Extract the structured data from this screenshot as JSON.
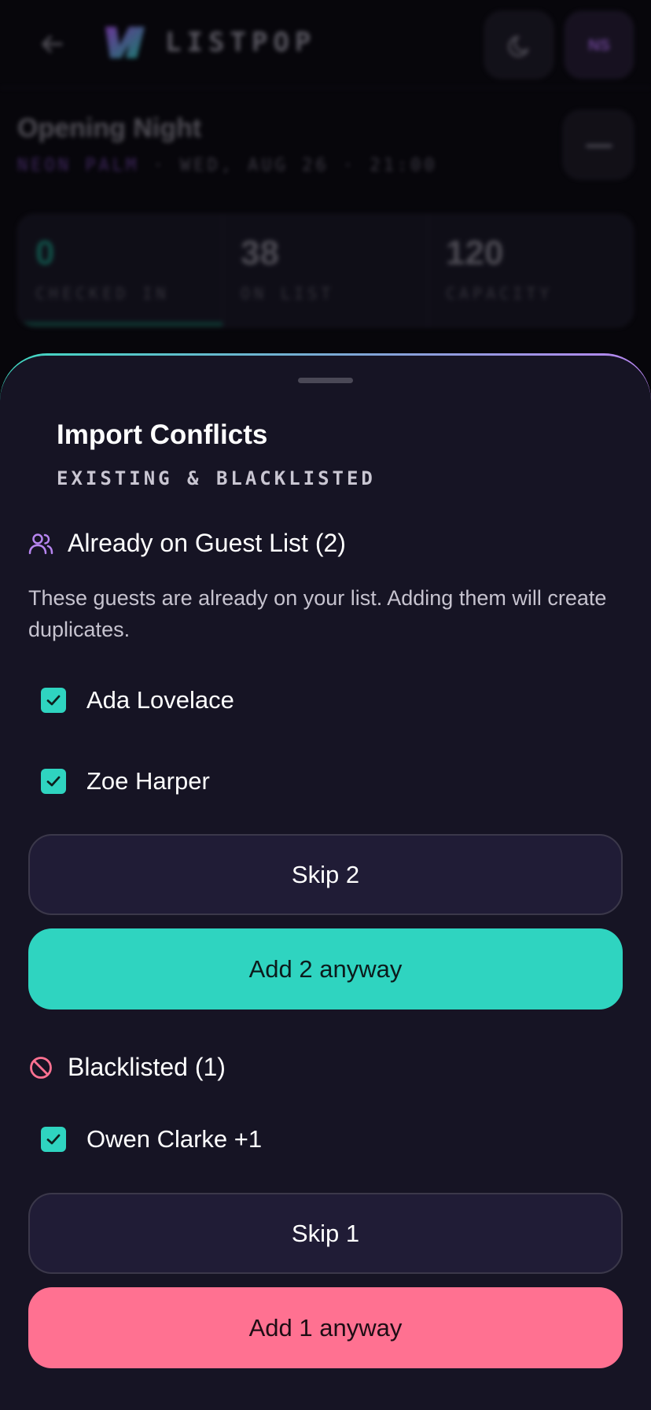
{
  "app": {
    "brand": "LISTPOP",
    "avatar_initials": "NS"
  },
  "event": {
    "title": "Opening Night",
    "venue": "NEON PALM",
    "datetime": "· WED, AUG 26 · 21:00"
  },
  "stats": [
    {
      "value": "0",
      "label": "CHECKED IN"
    },
    {
      "value": "38",
      "label": "ON LIST"
    },
    {
      "value": "120",
      "label": "CAPACITY"
    }
  ],
  "sheet": {
    "title": "Import Conflicts",
    "subtitle": "EXISTING & BLACKLISTED",
    "existing": {
      "heading": "Already on Guest List (2)",
      "description": "These guests are already on your list. Adding them will create duplicates.",
      "guests": [
        "Ada Lovelace",
        "Zoe Harper"
      ],
      "skip_label": "Skip 2",
      "add_label": "Add 2 anyway"
    },
    "blacklisted": {
      "heading": "Blacklisted (1)",
      "guests": [
        "Owen Clarke +1"
      ],
      "skip_label": "Skip 1",
      "add_label": "Add 1 anyway"
    }
  },
  "colors": {
    "accent_teal": "#2fd4c0",
    "accent_pink": "#ff7191",
    "accent_purple": "#b785f0",
    "sheet_bg": "#161424"
  },
  "icons": {
    "back": "arrow-left-icon",
    "theme": "moon-icon",
    "existing": "users-icon",
    "blacklisted": "ban-icon",
    "checkbox": "check-icon"
  }
}
